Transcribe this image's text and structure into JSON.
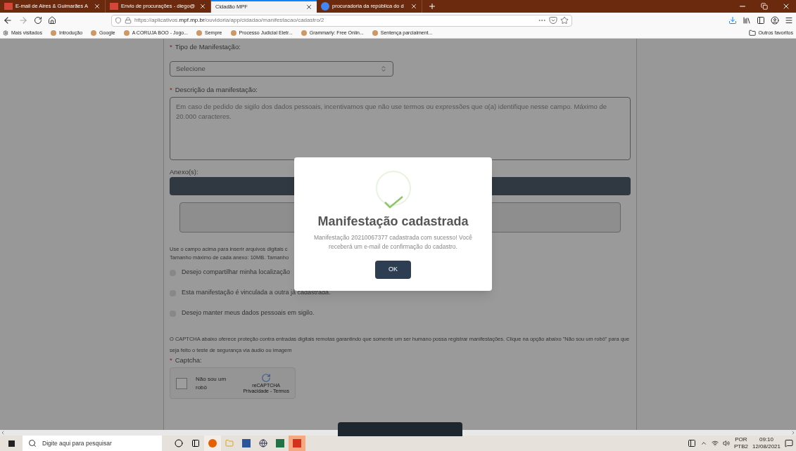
{
  "browser": {
    "tabs": [
      {
        "label": "E-mail de Aires & Guimarães A",
        "selected": false,
        "kind": "gmail"
      },
      {
        "label": "Envio de procurações - diego@",
        "selected": false,
        "kind": "gmail"
      },
      {
        "label": "Cidadão MPF",
        "selected": true,
        "kind": "page"
      },
      {
        "label": "procuradoria da república do d",
        "selected": false,
        "kind": "google"
      }
    ],
    "url": {
      "prefix": "https://aplicativos.",
      "domain": "mpf.mp.br",
      "path": "/ouvidoria/app/cidadao/manifestacao/cadastro/2"
    },
    "bookmarks": [
      "Mais visitados",
      "Introdução",
      "Google",
      "A CORUJA BOO - Jogo...",
      "Sempre",
      "Processo Judicial Eletr...",
      "Grammarly: Free Onlin...",
      "Sentença parcialment..."
    ],
    "other_bookmarks": "Outros favoritos"
  },
  "form": {
    "required_marks": [
      "*",
      "*",
      "*"
    ],
    "type_label": "Tipo de Manifestação:",
    "type_select": "Selecione",
    "description_label": "Descrição da manifestação:",
    "description_placeholder": "Em caso de pedido de sigilo dos dados pessoais, incentivamos que não use termos ou expressões que o(a) identifique nesse campo. Máximo de 20.000 caracteres.",
    "attachments_label": "Anexo(s):",
    "help_lines": [
      "Use o campo acima para inserir arquivos digitais c",
      "Tamanho máximo de cada anexo: 10MB. Tamanho"
    ],
    "options": [
      {
        "label": "Desejo compartilhar minha localização",
        "checked": false
      },
      {
        "label": "Esta manifestação é vinculada a outra já cadastrada.",
        "checked": false
      },
      {
        "label": "Desejo manter meus dados pessoais em sigilo.",
        "checked": false
      }
    ],
    "captcha_info": "O CAPTCHA abaixo oferece proteção contra entradas digitais remotas garantindo que somente um ser humano possa registrar manifestações. Clique na opção abaixo \"Não sou um robô\" para que seja feito o teste de segurança via áudio ou imagem",
    "captcha_label": "Captcha:",
    "recaptcha": {
      "label": "Não sou um robô",
      "checked": false,
      "brand": "reCAPTCHA",
      "links": "Privacidade - Termos"
    }
  },
  "dialog": {
    "title": "Manifestação cadastrada",
    "message": "Manifestação 20210067377 cadastrada com sucesso! Você receberá um e-mail de confirmação do cadastro.",
    "button": "OK"
  },
  "taskbar": {
    "search_placeholder": "Digite aqui para pesquisar",
    "language": "POR",
    "layout": "PTB2",
    "time": "09:10",
    "date": "12/08/2021"
  }
}
